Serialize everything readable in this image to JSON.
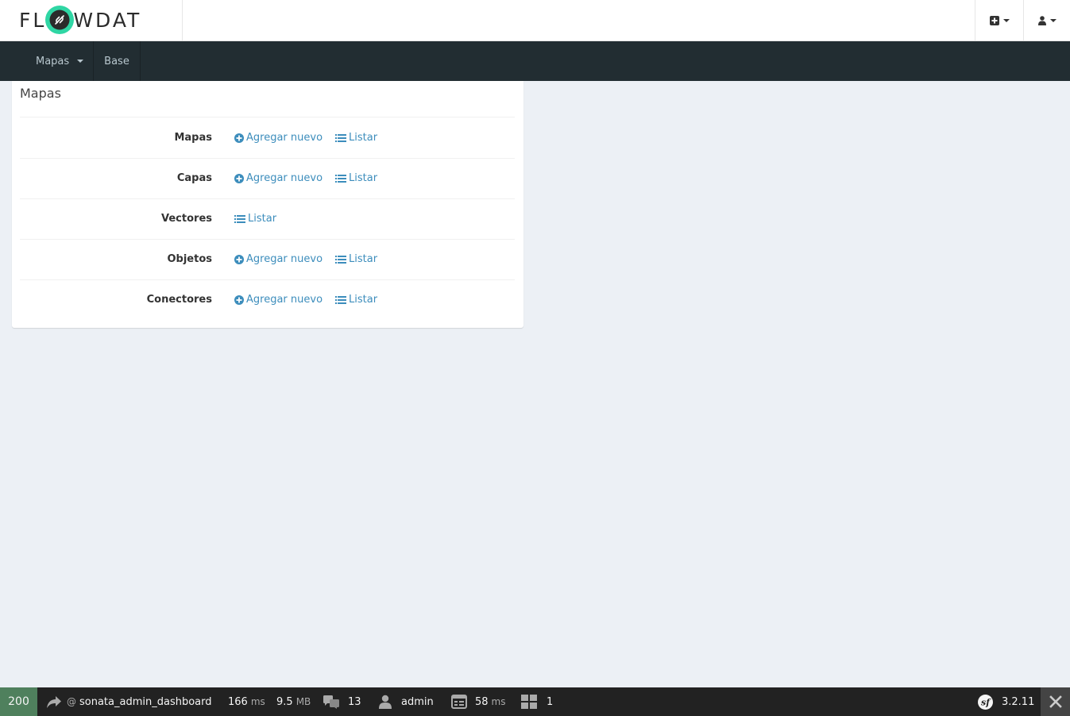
{
  "header": {
    "logo_left": "FL",
    "logo_right": "WDAT",
    "accent_color": "#2fd6a4"
  },
  "navbar": {
    "items": [
      {
        "label": "Mapas",
        "has_dropdown": true
      },
      {
        "label": "Base",
        "has_dropdown": false
      }
    ]
  },
  "panel": {
    "title": "Mapas",
    "rows": [
      {
        "label": "Mapas",
        "add_label": "Agregar nuevo",
        "list_label": "Listar"
      },
      {
        "label": "Capas",
        "add_label": "Agregar nuevo",
        "list_label": "Listar"
      },
      {
        "label": "Vectores",
        "list_label": "Listar"
      },
      {
        "label": "Objetos",
        "add_label": "Agregar nuevo",
        "list_label": "Listar"
      },
      {
        "label": "Conectores",
        "add_label": "Agregar nuevo",
        "list_label": "Listar"
      }
    ]
  },
  "debug_toolbar": {
    "status_code": "200",
    "route_prefix": "@",
    "route": "sonata_admin_dashboard",
    "time_value": "166",
    "time_unit": "ms",
    "memory_value": "9.5",
    "memory_unit": "MB",
    "translations_count": "13",
    "user": "admin",
    "db_time_value": "58",
    "db_time_unit": "ms",
    "forms_count": "1",
    "symfony_version": "3.2.11",
    "status_color": "#4f805d"
  }
}
